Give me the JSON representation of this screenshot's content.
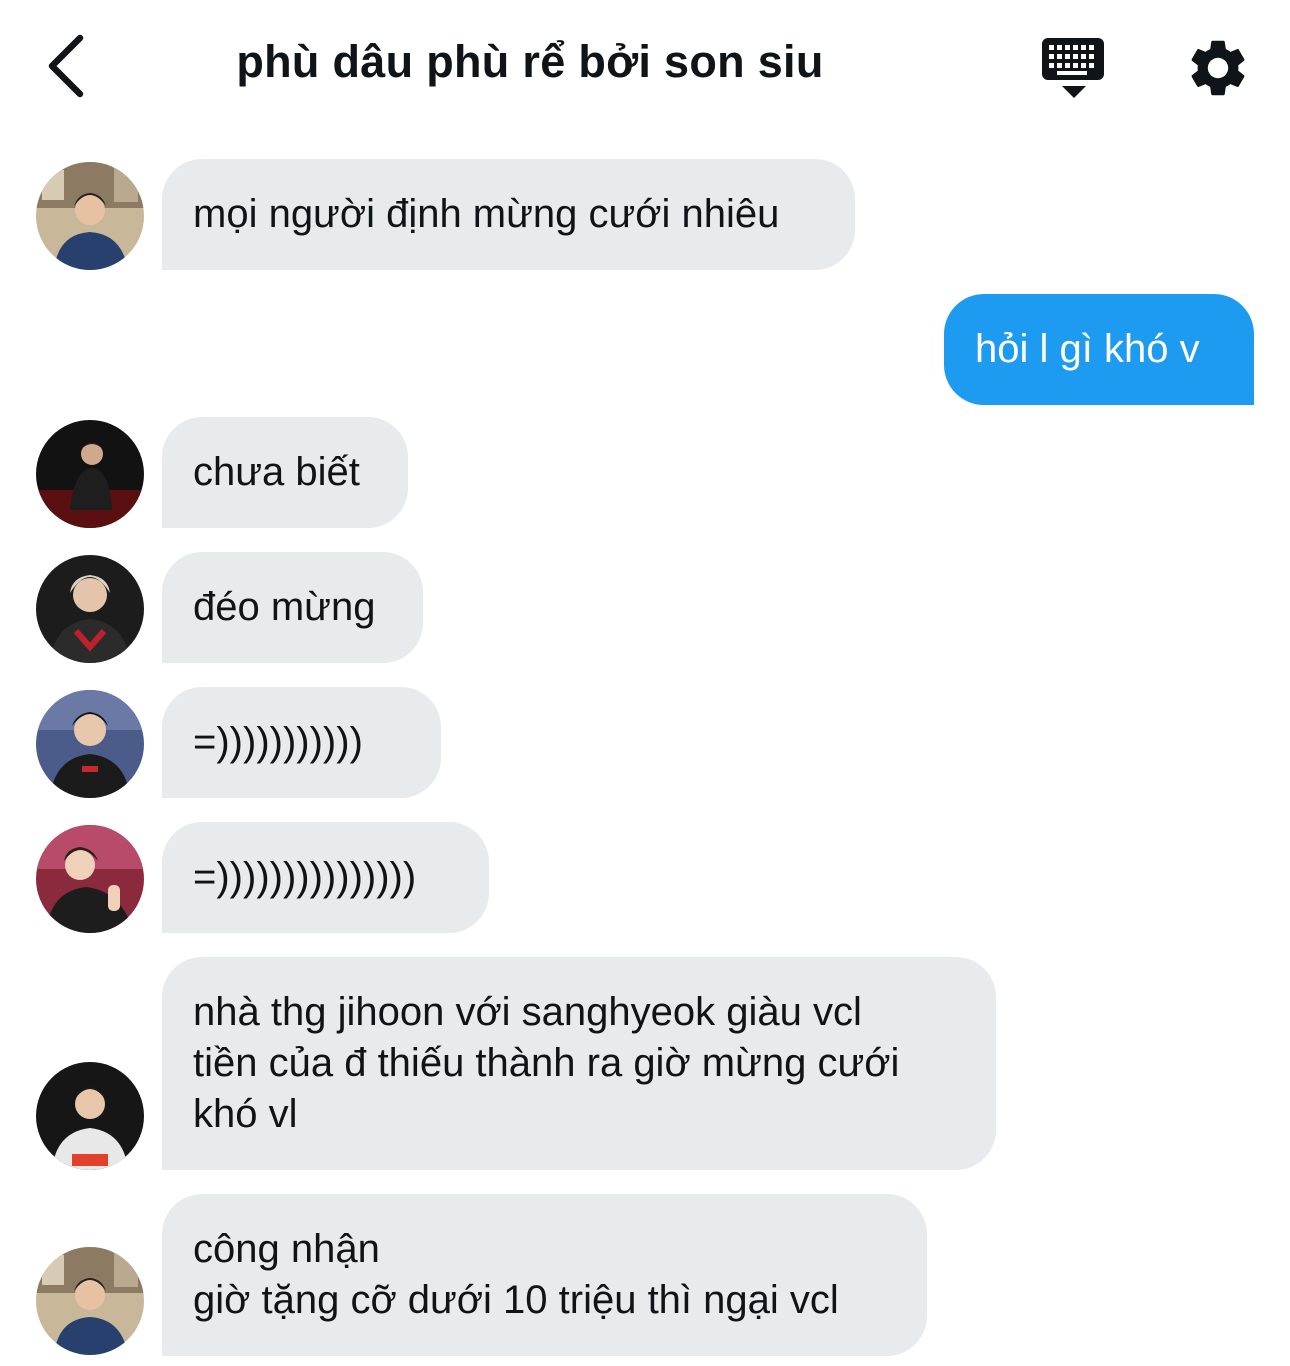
{
  "header": {
    "title": "phù dâu phù rể bởi son siu",
    "back_icon": "chevron-left-icon",
    "keyboard_icon": "keyboard-icon",
    "settings_icon": "gear-icon"
  },
  "colors": {
    "incoming_bubble": "#e7ebee",
    "outgoing_bubble": "#1d9bf0",
    "text": "#0f1419"
  },
  "messages": [
    {
      "direction": "incoming",
      "avatar": "avatar-1",
      "lines": [
        "mọi người định mừng cưới nhiêu"
      ]
    },
    {
      "direction": "outgoing",
      "lines": [
        "hỏi l gì khó v"
      ]
    },
    {
      "direction": "incoming",
      "avatar": "avatar-2",
      "lines": [
        "chưa biết"
      ]
    },
    {
      "direction": "incoming",
      "avatar": "avatar-3",
      "lines": [
        "đéo mừng"
      ]
    },
    {
      "direction": "incoming",
      "avatar": "avatar-4",
      "lines": [
        "=)))))))))))"
      ]
    },
    {
      "direction": "incoming",
      "avatar": "avatar-5",
      "lines": [
        "=)))))))))))))))"
      ]
    },
    {
      "direction": "incoming",
      "avatar": "avatar-6",
      "lines": [
        "nhà thg jihoon với sanghyeok giàu vcl",
        "tiền của đ thiếu thành ra giờ mừng cưới",
        "khó vl"
      ]
    },
    {
      "direction": "incoming",
      "avatar": "avatar-1",
      "lines": [
        "công nhận",
        "giờ tặng cỡ dưới 10 triệu thì ngại vcl"
      ]
    }
  ]
}
